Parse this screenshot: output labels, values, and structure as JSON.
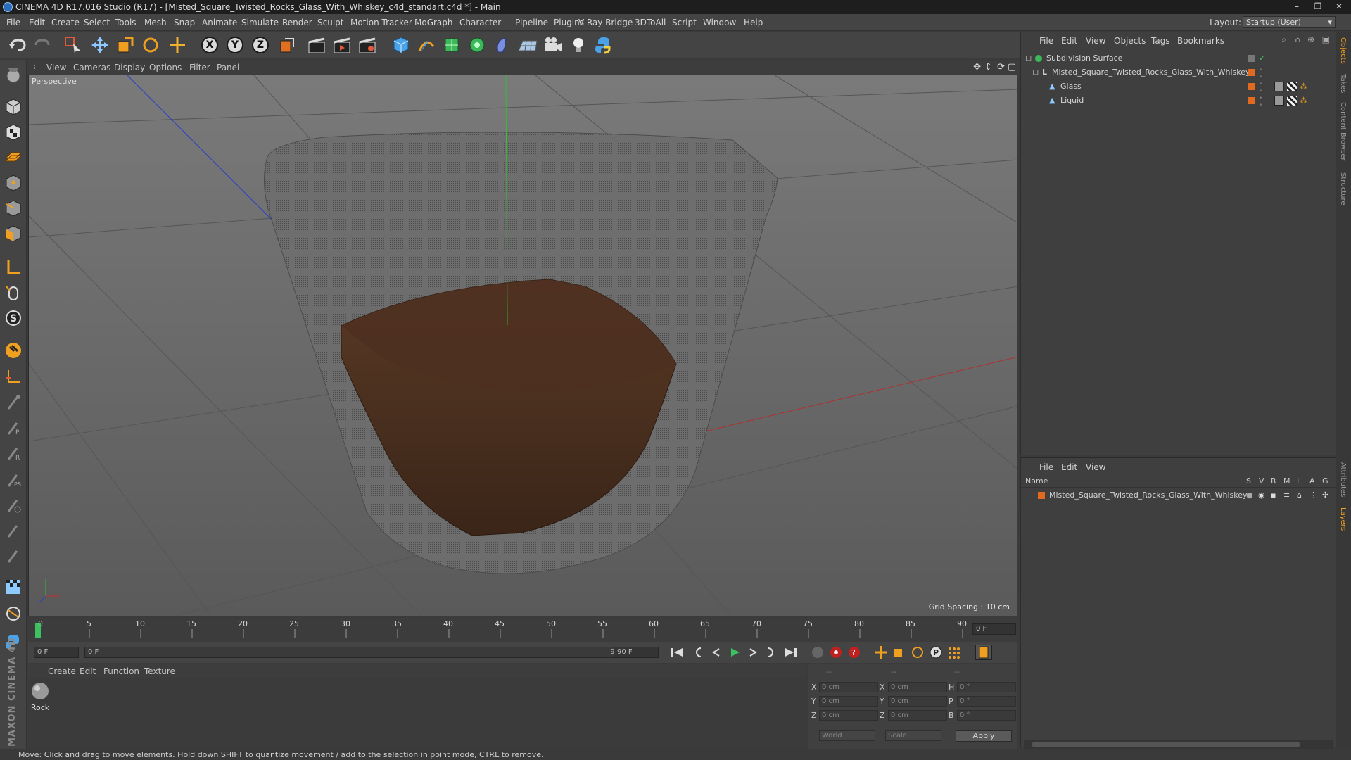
{
  "window": {
    "title": "CINEMA 4D R17.016 Studio (R17) - [Misted_Square_Twisted_Rocks_Glass_With_Whiskey_c4d_standart.c4d *] - Main",
    "controls": [
      "–",
      "❐",
      "✕"
    ]
  },
  "menubar": {
    "items": [
      "File",
      "Edit",
      "Create",
      "Select",
      "Tools",
      "Mesh",
      "Snap",
      "Animate",
      "Simulate",
      "Render",
      "Sculpt",
      "Motion Tracker",
      "MoGraph",
      "Character",
      "Pipeline",
      "Plugins",
      "V-Ray Bridge",
      "3DToAll",
      "Script",
      "Window",
      "Help"
    ],
    "layout_label": "Layout:",
    "layout_value": "Startup (User)"
  },
  "viewport": {
    "menu": [
      "View",
      "Cameras",
      "Display",
      "Options",
      "Filter",
      "Panel"
    ],
    "label": "Perspective",
    "grid_spacing": "Grid Spacing : 10 cm"
  },
  "timeline": {
    "ticks": [
      "0",
      "5",
      "10",
      "15",
      "20",
      "25",
      "30",
      "35",
      "40",
      "45",
      "50",
      "55",
      "60",
      "65",
      "70",
      "75",
      "80",
      "85",
      "90"
    ],
    "frame_end_field": "0 F",
    "current_frame": "0 F",
    "range_start": "0 F",
    "range_end": "90 F",
    "end_frame": "90 F"
  },
  "materials": {
    "menu": [
      "Create",
      "Edit",
      "Function",
      "Texture"
    ],
    "items": [
      {
        "name": "Rock"
      }
    ]
  },
  "coordinates": {
    "headers": [
      "--",
      "--",
      "--"
    ],
    "rows": [
      {
        "a": "X",
        "av": "0 cm",
        "b": "X",
        "bv": "0 cm",
        "c": "H",
        "cv": "0 °"
      },
      {
        "a": "Y",
        "av": "0 cm",
        "b": "Y",
        "bv": "0 cm",
        "c": "P",
        "cv": "0 °"
      },
      {
        "a": "Z",
        "av": "0 cm",
        "b": "Z",
        "bv": "0 cm",
        "c": "B",
        "cv": "0 °"
      }
    ],
    "mode": "World",
    "scale": "Scale",
    "apply": "Apply"
  },
  "objects": {
    "menu": [
      "File",
      "Edit",
      "View",
      "Objects",
      "Tags",
      "Bookmarks"
    ],
    "tree": [
      {
        "name": "Subdivision Surface"
      },
      {
        "name": "Misted_Square_Twisted_Rocks_Glass_With_Whiskey"
      },
      {
        "name": "Glass"
      },
      {
        "name": "Liquid"
      }
    ]
  },
  "layers": {
    "menu": [
      "File",
      "Edit",
      "View"
    ],
    "columns": [
      "Name",
      "S",
      "V",
      "R",
      "M",
      "L",
      "A",
      "G"
    ],
    "rows": [
      {
        "name": "Misted_Square_Twisted_Rocks_Glass_With_Whiskey"
      }
    ]
  },
  "right_tabs": [
    "Objects",
    "Takes",
    "Content Browser",
    "Structure",
    "Attributes",
    "Layers"
  ],
  "brand": "MAXON CINEMA 4D",
  "status": "Move: Click and drag to move elements. Hold down SHIFT to quantize movement / add to the selection in point mode, CTRL to remove.",
  "colors": {
    "accent_orange": "#e06a1f",
    "whiskey": "#4a3020",
    "viewport_bg": "#6c6c6c"
  }
}
